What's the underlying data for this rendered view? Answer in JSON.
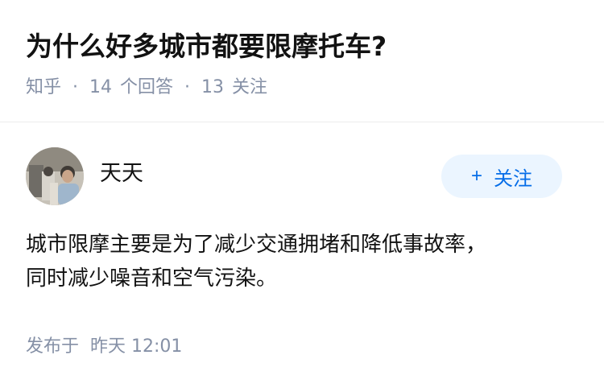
{
  "question": {
    "title": "为什么好多城市都要限摩托车?",
    "source": "知乎",
    "separator": "·",
    "answer_count": "14",
    "answer_label": "个回答",
    "follow_count": "13",
    "follow_label": "关注"
  },
  "answer": {
    "author_name": "天天",
    "follow_button_label": "关注",
    "follow_icon": "plus-icon",
    "paragraphs": [
      "城市限摩主要是为了减少交通拥堵和降低事故率，",
      "同时减少噪音和空气污染。"
    ],
    "post_time_label": "发布于",
    "post_time_value": "昨天 12:01"
  },
  "colors": {
    "title": "#121212",
    "meta": "#8590a6",
    "accent": "#056de8",
    "button_bg": "#ebf5ff"
  }
}
